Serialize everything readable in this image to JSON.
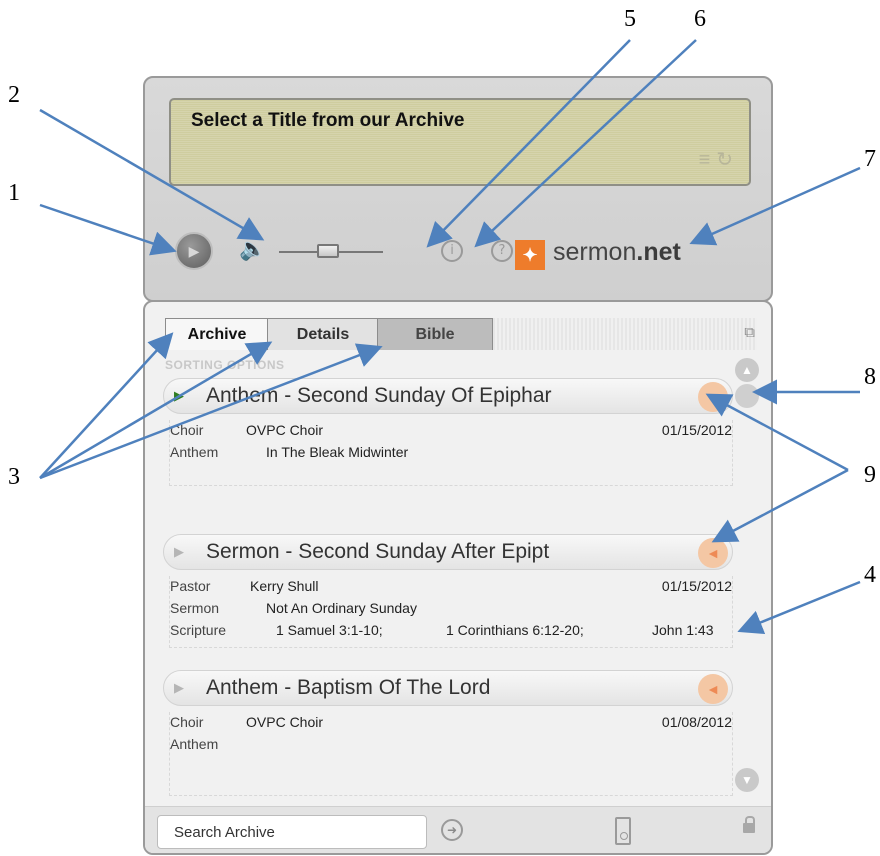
{
  "display": {
    "title": "Select a Title from our Archive",
    "icons": [
      "list-icon",
      "refresh-icon"
    ]
  },
  "controls": {
    "icons": [
      "play-icon",
      "speaker-icon",
      "volume-slider",
      "info-icon",
      "help-icon"
    ],
    "info_glyph": "i",
    "help_glyph": "?"
  },
  "logo": {
    "prefix": "sermon",
    "suffix": ".net"
  },
  "tabs": [
    {
      "label": "Archive"
    },
    {
      "label": "Details"
    },
    {
      "label": "Bible"
    }
  ],
  "sorting_label": "SORTING OPTIONS",
  "entries": [
    {
      "title": "Anthem - Second Sunday Of Epiphar",
      "arrow_color": "#2e7d1f",
      "fields": [
        {
          "label": "Choir",
          "value": "OVPC Choir",
          "date": "01/15/2012"
        },
        {
          "label": "Anthem",
          "value": "In The Bleak Midwinter"
        }
      ]
    },
    {
      "title": "Sermon - Second Sunday After Epipt",
      "arrow_color": "#b5b5b5",
      "fields": [
        {
          "label": "Pastor",
          "value": "Kerry Shull",
          "date": "01/15/2012"
        },
        {
          "label": "Sermon",
          "value": "Not An Ordinary Sunday"
        },
        {
          "label": "Scripture",
          "parts": [
            "1 Samuel 3:1-10;",
            "1 Corinthians 6:12-20;",
            "John 1:43"
          ]
        }
      ]
    },
    {
      "title": "Anthem - Baptism Of The Lord",
      "arrow_color": "#b5b5b5",
      "fields": [
        {
          "label": "Choir",
          "value": "OVPC Choir",
          "date": "01/08/2012"
        },
        {
          "label": "Anthem",
          "value": ""
        }
      ]
    }
  ],
  "search": {
    "value": "Search Archive"
  },
  "callouts": [
    "1",
    "2",
    "3",
    "4",
    "5",
    "6",
    "7",
    "8",
    "9"
  ]
}
